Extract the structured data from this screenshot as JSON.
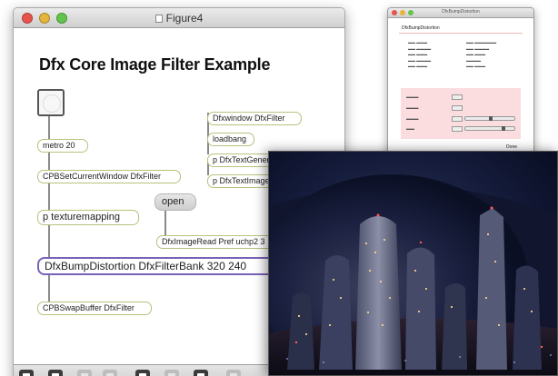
{
  "main_window": {
    "title": "Figure4",
    "heading": "Dfx Core Image Filter Example",
    "objects": {
      "metro": "metro 20",
      "set_current_window": "CPBSetCurrentWindow DfxFilter",
      "texture_mapping": "p texturemapping",
      "bump_distortion": "DfxBumpDistortion DfxFilterBank 320 240",
      "swap_buffer": "CPBSwapBuffer DfxFilter",
      "window": "Dfxwindow DfxFilter",
      "loadbang": "loadbang",
      "text_generator": "p DfxTextGenerator Text",
      "text_image": "p DfxTextImage",
      "image_read": "DfxImageRead Pref uchp2 3"
    },
    "open_message": "open"
  },
  "inspector_window": {
    "title": "DfxBumpDistortion",
    "heading": "DfxBumpDistortion",
    "done_label": "Done"
  },
  "colors": {
    "object_border": "#b7c27c",
    "selected_object_border": "#7a61b8",
    "inspector_pink": "#fbdde0",
    "night_sky": "#080d22"
  },
  "icons": [
    "close-light",
    "minimize-light",
    "zoom-light",
    "lock-icon",
    "presentation-icon",
    "grid-icon",
    "patcher-icon",
    "comment-icon",
    "inspector-icon",
    "new-object-icon"
  ]
}
